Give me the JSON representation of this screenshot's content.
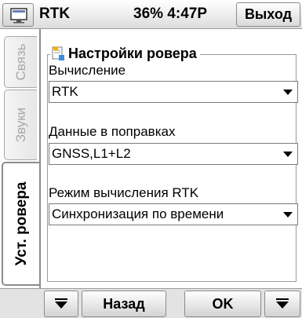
{
  "titlebar": {
    "start_icon": "windows-start-icon",
    "app_title": "RTK",
    "status": "36% 4:47P",
    "exit_label": "Выход"
  },
  "tabs": [
    {
      "label": "Связь",
      "active": false
    },
    {
      "label": "Звуки",
      "active": false
    },
    {
      "label": "Уст. ровера",
      "active": true
    }
  ],
  "group": {
    "icon": "settings-document-icon",
    "title": "Настройки ровера"
  },
  "fields": {
    "computation": {
      "label": "Вычисление",
      "value": "RTK"
    },
    "corrections": {
      "label": "Данные в поправках",
      "value": "GNSS,L1+L2"
    },
    "rtk_mode": {
      "label": "Режим вычисления RTK",
      "value": "Синхронизация по времени"
    }
  },
  "bottombar": {
    "back_label": "Назад",
    "ok_label": "OK",
    "menu_icon": "triangle-down-icon"
  }
}
